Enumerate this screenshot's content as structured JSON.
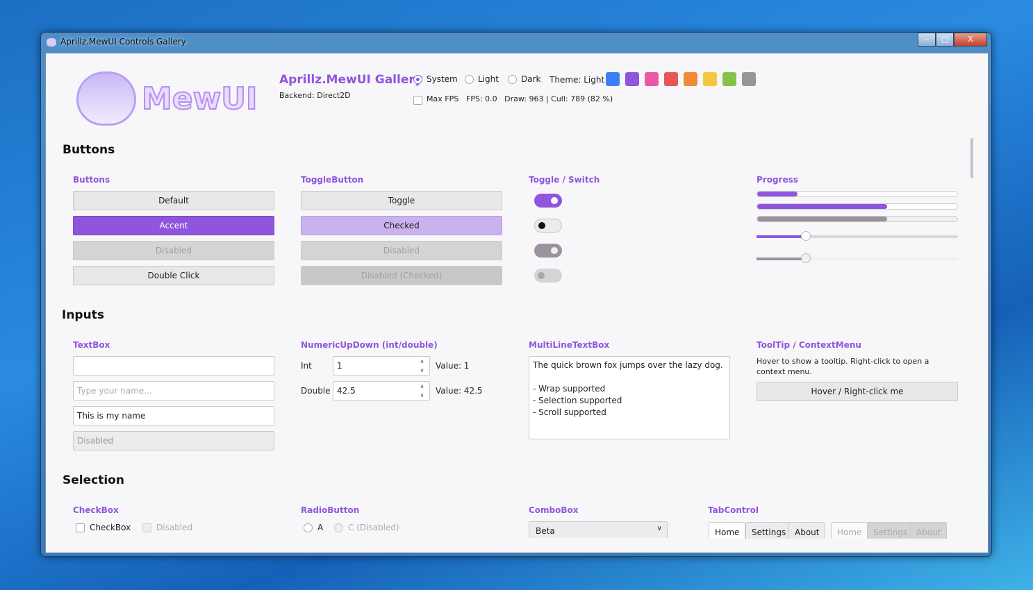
{
  "window": {
    "title": "Aprillz.MewUI Controls Gallery",
    "minimize": "‒",
    "maximize": "□",
    "close": "X"
  },
  "header": {
    "logo_text": "MewUI",
    "app_title": "Aprillz.MewUI Gallery",
    "backend": "Backend: Direct2D",
    "theme_options": [
      "System",
      "Light",
      "Dark"
    ],
    "theme_selected": "System",
    "theme_label": "Theme: Light",
    "accent_colors": [
      "#3b7ff5",
      "#9055dd",
      "#e85aa5",
      "#e85555",
      "#ef8c35",
      "#f4c642",
      "#86c24a",
      "#969696"
    ],
    "max_fps_label": "Max FPS",
    "stats": "FPS: 0.0   Draw: 963 | Cull: 789 (82 %)"
  },
  "buttons": {
    "section": "Buttons",
    "buttons_col": {
      "label": "Buttons",
      "items": [
        "Default",
        "Accent",
        "Disabled",
        "Double Click"
      ]
    },
    "toggle_col": {
      "label": "ToggleButton",
      "items": [
        "Toggle",
        "Checked",
        "Disabled",
        "Disabled (Checked)"
      ]
    },
    "switch_col": {
      "label": "Toggle / Switch"
    },
    "progress_col": {
      "label": "Progress",
      "progress_values": [
        20,
        65,
        65
      ],
      "slider_values": [
        25,
        25
      ]
    }
  },
  "inputs": {
    "section": "Inputs",
    "textbox": {
      "label": "TextBox",
      "values": [
        "",
        "",
        "This is my name",
        "Disabled"
      ],
      "placeholder": "Type your name..."
    },
    "numeric": {
      "label": "NumericUpDown (int/double)",
      "int_label": "Int",
      "int_value": "1",
      "int_display": "Value: 1",
      "double_label": "Double",
      "double_value": "42.5",
      "double_display": "Value: 42.5"
    },
    "multiline": {
      "label": "MultiLineTextBox",
      "lines": [
        "The quick brown fox jumps over the lazy dog.",
        "",
        "- Wrap supported",
        "- Selection supported",
        "- Scroll supported"
      ]
    },
    "tooltip": {
      "label": "ToolTip / ContextMenu",
      "description": "Hover to show a tooltip. Right-click to open a context menu.",
      "button": "Hover / Right-click me"
    }
  },
  "selection": {
    "section": "Selection",
    "checkbox": {
      "label": "CheckBox",
      "items": [
        "CheckBox",
        "Disabled"
      ]
    },
    "radio": {
      "label": "RadioButton",
      "items": [
        "A",
        "C (Disabled)"
      ]
    },
    "combo": {
      "label": "ComboBox",
      "value": "Beta"
    },
    "tabs": {
      "label": "TabControl",
      "items": [
        "Home",
        "Settings",
        "About"
      ]
    }
  }
}
